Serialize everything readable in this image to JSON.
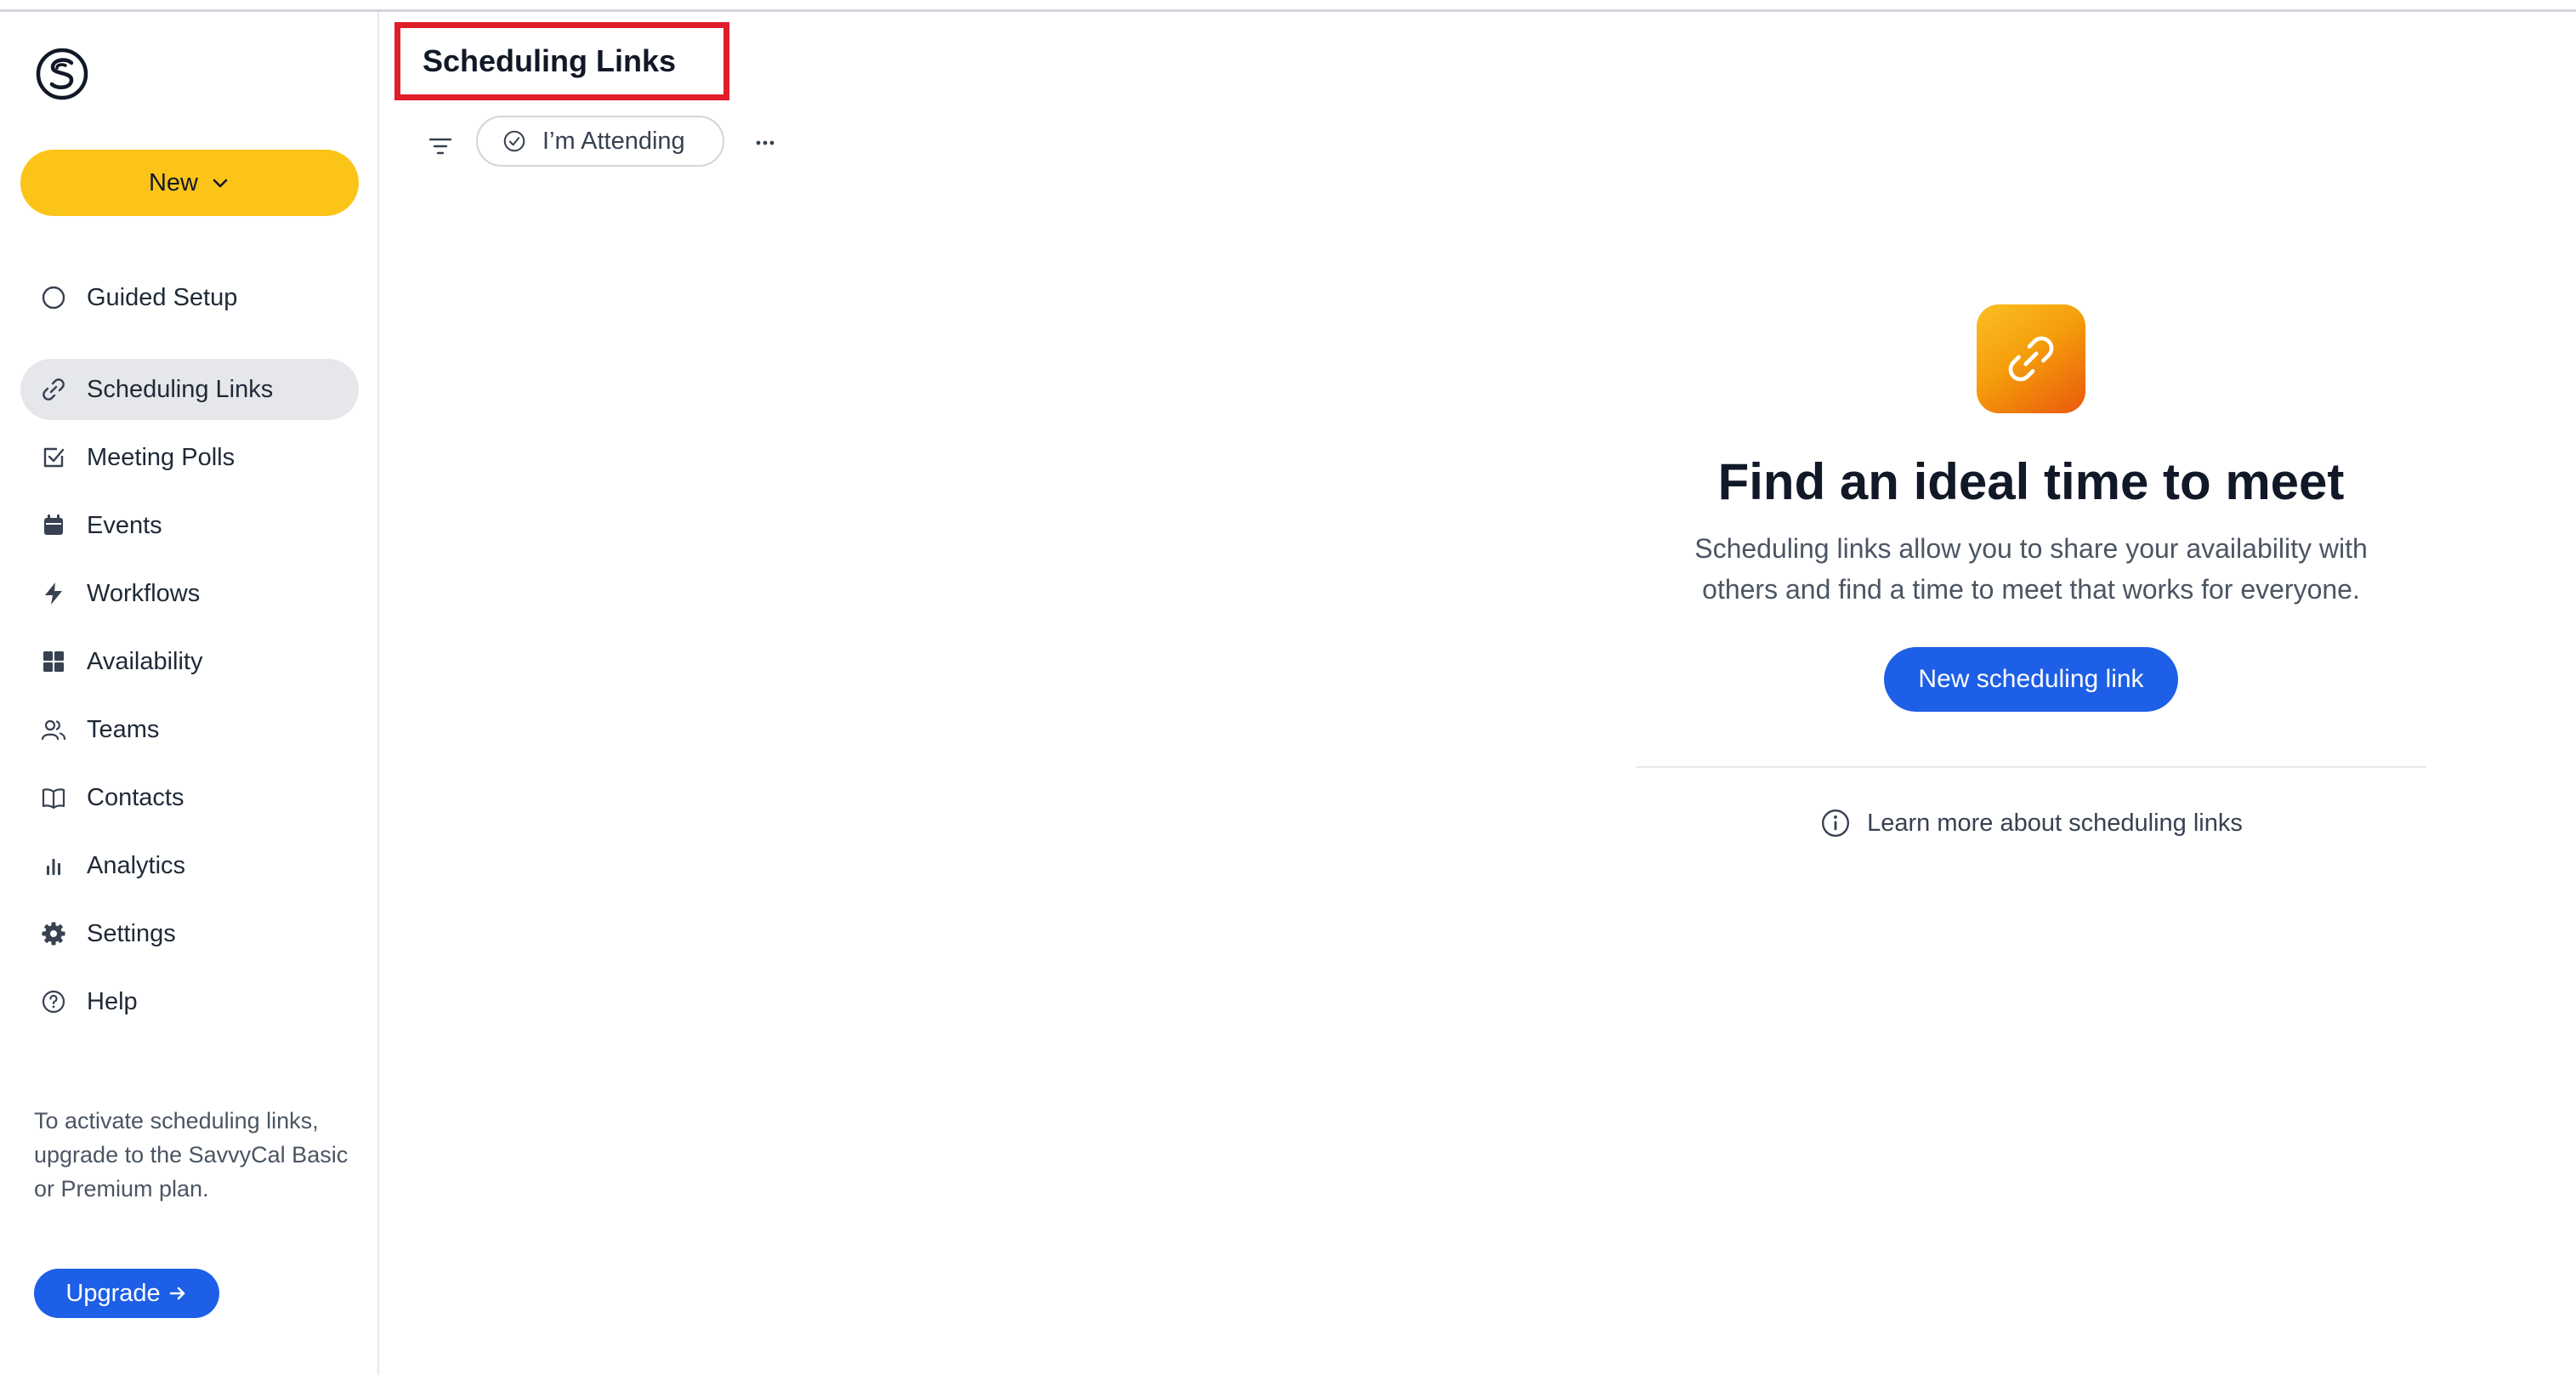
{
  "sidebar": {
    "new_label": "New",
    "items": [
      {
        "label": "Guided Setup",
        "icon": "circle-icon"
      },
      {
        "label": "Scheduling Links",
        "icon": "link-icon",
        "active": true
      },
      {
        "label": "Meeting Polls",
        "icon": "checkbox-icon"
      },
      {
        "label": "Events",
        "icon": "calendar-icon"
      },
      {
        "label": "Workflows",
        "icon": "lightning-icon"
      },
      {
        "label": "Availability",
        "icon": "grid-icon"
      },
      {
        "label": "Teams",
        "icon": "users-icon"
      },
      {
        "label": "Contacts",
        "icon": "book-icon"
      },
      {
        "label": "Analytics",
        "icon": "bar-chart-icon"
      },
      {
        "label": "Settings",
        "icon": "gear-icon"
      },
      {
        "label": "Help",
        "icon": "question-icon"
      }
    ],
    "upgrade_text": "To activate scheduling links, upgrade to the SavvyCal Basic or Premium plan.",
    "upgrade_label": "Upgrade"
  },
  "header": {
    "title": "Scheduling Links",
    "filter_chip_label": "I’m Attending"
  },
  "empty_state": {
    "title": "Find an ideal time to meet",
    "description": "Scheduling links allow you to share your availability with others and find a time to meet that works for everyone.",
    "button_label": "New scheduling link",
    "learn_more_label": "Learn more about scheduling links"
  },
  "colors": {
    "accent_yellow": "#fcc419",
    "primary_blue": "#1d5fe6",
    "highlight_red": "#e11d2a",
    "active_bg": "#e5e7eb"
  }
}
